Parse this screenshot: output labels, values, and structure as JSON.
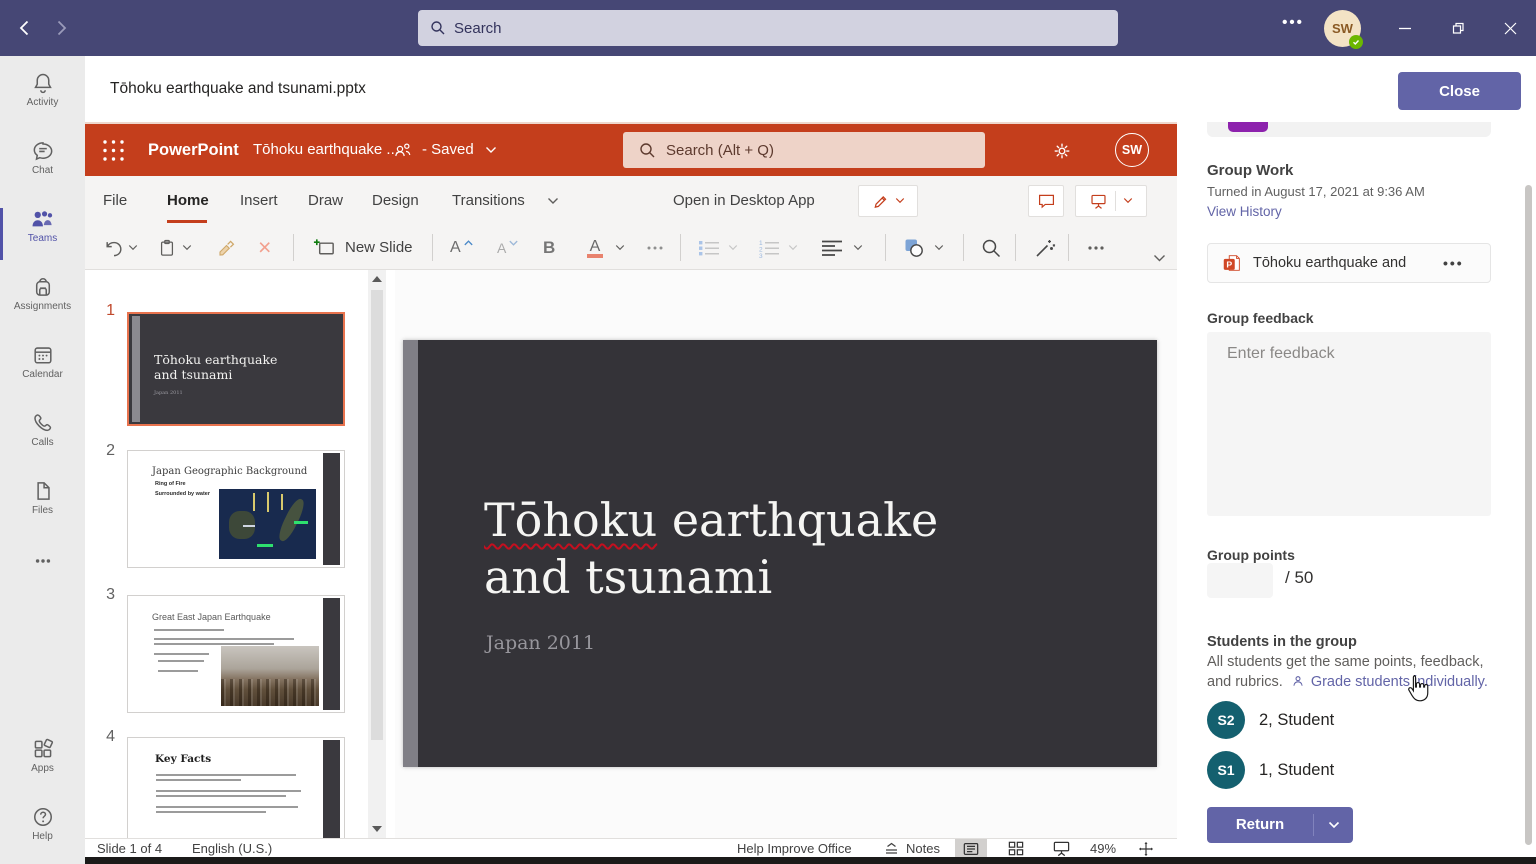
{
  "topbar": {
    "search_placeholder": "Search",
    "avatar_initials": "SW"
  },
  "rail": {
    "activity": "Activity",
    "chat": "Chat",
    "teams": "Teams",
    "assignments": "Assignments",
    "calendar": "Calendar",
    "calls": "Calls",
    "files": "Files",
    "apps": "Apps",
    "help": "Help"
  },
  "doc_header": {
    "title": "Tōhoku earthquake and tsunami.pptx",
    "close_label": "Close"
  },
  "ppt_header": {
    "app_name": "PowerPoint",
    "doc_title": "Tōhoku earthquake ...",
    "save_status": "- Saved",
    "search_placeholder": "Search (Alt + Q)",
    "avatar_initials": "SW"
  },
  "ribbon": {
    "tabs": [
      "File",
      "Home",
      "Insert",
      "Draw",
      "Design",
      "Transitions"
    ],
    "open_desktop_label": "Open in Desktop App",
    "new_slide_label": "New Slide",
    "bold_glyph": "B",
    "font_glyph": "A"
  },
  "thumbnails": {
    "s1": {
      "number": "1",
      "line1": "Tōhoku earthquake",
      "line2": "and tsunami",
      "subtitle": "Japan 2011"
    },
    "s2": {
      "number": "2",
      "title": "Japan Geographic Background",
      "bullet1": "Ring of Fire",
      "bullet2": "Surrounded by water"
    },
    "s3": {
      "number": "3",
      "title": "Great East Japan Earthquake"
    },
    "s4": {
      "number": "4",
      "title": "Key Facts"
    }
  },
  "canvas": {
    "title_word": "Tōhoku",
    "title_rest": " earthquake",
    "title_line2": "and tsunami",
    "subtitle": "Japan 2011"
  },
  "statusbar": {
    "slide_indicator": "Slide 1 of 4",
    "language": "English (U.S.)",
    "help_improve": "Help Improve Office",
    "notes_label": "Notes",
    "zoom_level": "49%"
  },
  "panel": {
    "title": "Group Work",
    "turned_in": "Turned in August 17, 2021 at 9:36 AM",
    "view_history": "View History",
    "attachment_name": "Tōhoku earthquake and",
    "feedback_label": "Group feedback",
    "feedback_placeholder": "Enter feedback",
    "points_label": "Group points",
    "points_suffix": "/ 50",
    "students_heading": "Students in the group",
    "students_note": "All students get the same points, feedback, and rubrics.",
    "grade_link": "Grade students individually.",
    "students": [
      {
        "initials": "S2",
        "name": "2, Student"
      },
      {
        "initials": "S1",
        "name": "1, Student"
      }
    ],
    "return_label": "Return"
  },
  "colors": {
    "teams_topbar": "#464775",
    "teams_purple": "#6264a7",
    "ppt_red": "#c43e1c",
    "selection_orange": "#e8734e",
    "avatar_teal": "#14606f",
    "presence_green": "#6bb700"
  }
}
